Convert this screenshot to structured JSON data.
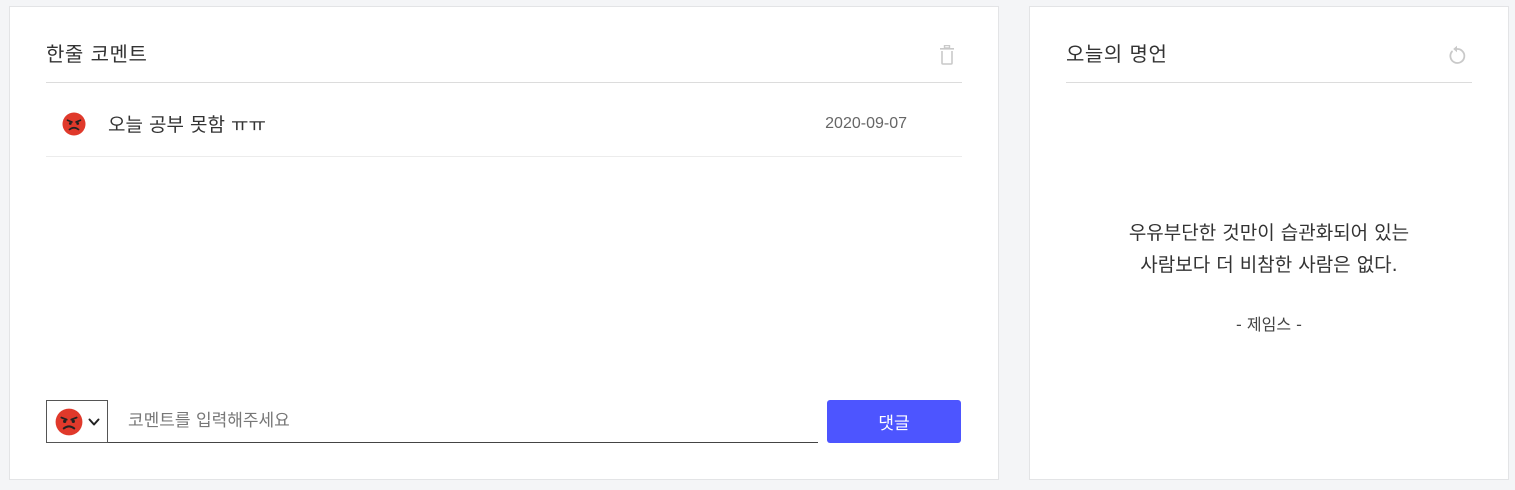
{
  "comment_panel": {
    "title": "한줄 코멘트",
    "delete_icon": "trash-icon",
    "comments": [
      {
        "emoji": "angry-face-icon",
        "text": "오늘 공부 못함 ㅠㅠ",
        "date": "2020-09-07"
      }
    ],
    "input": {
      "selected_emoji": "angry-face-icon",
      "value": "",
      "placeholder": "코멘트를 입력해주세요",
      "submit_label": "댓글"
    }
  },
  "quote_panel": {
    "title": "오늘의 명언",
    "refresh_icon": "refresh-icon",
    "quote_lines": [
      "우유부단한 것만이 습관화되어 있는",
      "사람보다 더 비참한 사람은 없다."
    ],
    "author": "- 제임스 -"
  },
  "colors": {
    "accent": "#4d55ff",
    "emoji_red": "#e0392b",
    "background": "#f4f5f7"
  }
}
